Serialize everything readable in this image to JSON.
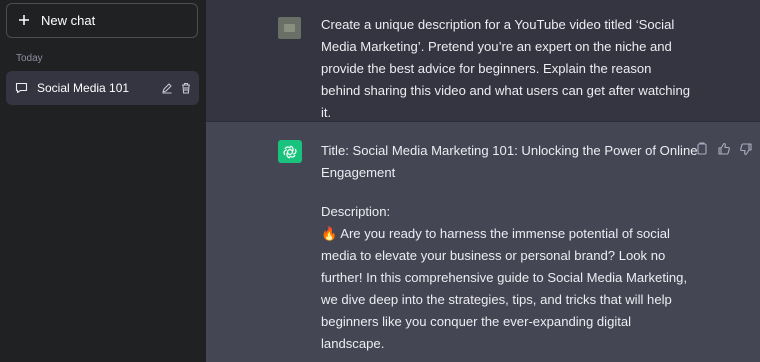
{
  "sidebar": {
    "new_chat_label": "New chat",
    "section_today": "Today",
    "conversations": [
      {
        "label": "Social Media 101"
      }
    ]
  },
  "chat": {
    "user_message": "Create a unique description for a YouTube video titled ‘Social Media Marketing’. Pretend you’re an expert on the niche and provide the best advice for beginners. Explain the reason behind sharing this video and what users can get after watching it.",
    "assistant": {
      "title_line": "Title: Social Media Marketing 101: Unlocking the Power of Online Engagement",
      "description_label": "Description:",
      "body": "🔥 Are you ready to harness the immense potential of social media to elevate your business or personal brand? Look no further! In this comprehensive guide to Social Media Marketing, we dive deep into the strategies, tips, and tricks that will help beginners like you conquer the ever-expanding digital landscape."
    }
  },
  "colors": {
    "sidebar_bg": "#202123",
    "main_bg": "#343541",
    "assistant_bg": "#444654",
    "accent": "#19c37d"
  },
  "icons": [
    "plus-icon",
    "chat-bubble-icon",
    "pencil-icon",
    "trash-icon",
    "openai-logo-icon",
    "copy-icon",
    "thumbs-up-icon",
    "thumbs-down-icon"
  ]
}
